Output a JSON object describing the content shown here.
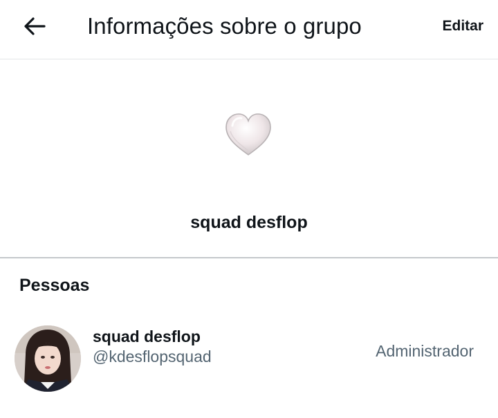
{
  "header": {
    "back_icon": "arrow-left-icon",
    "title": "Informações sobre o grupo",
    "edit_label": "Editar"
  },
  "group": {
    "avatar_icon": "heart-icon",
    "name": "squad desflop"
  },
  "people": {
    "section_title": "Pessoas",
    "members": [
      {
        "name": "squad desflop",
        "handle": "@kdesflopsquad",
        "role": "Administrador"
      }
    ]
  },
  "colors": {
    "text_primary": "#0f1419",
    "text_secondary": "#536471",
    "divider": "#c4c8cb"
  }
}
